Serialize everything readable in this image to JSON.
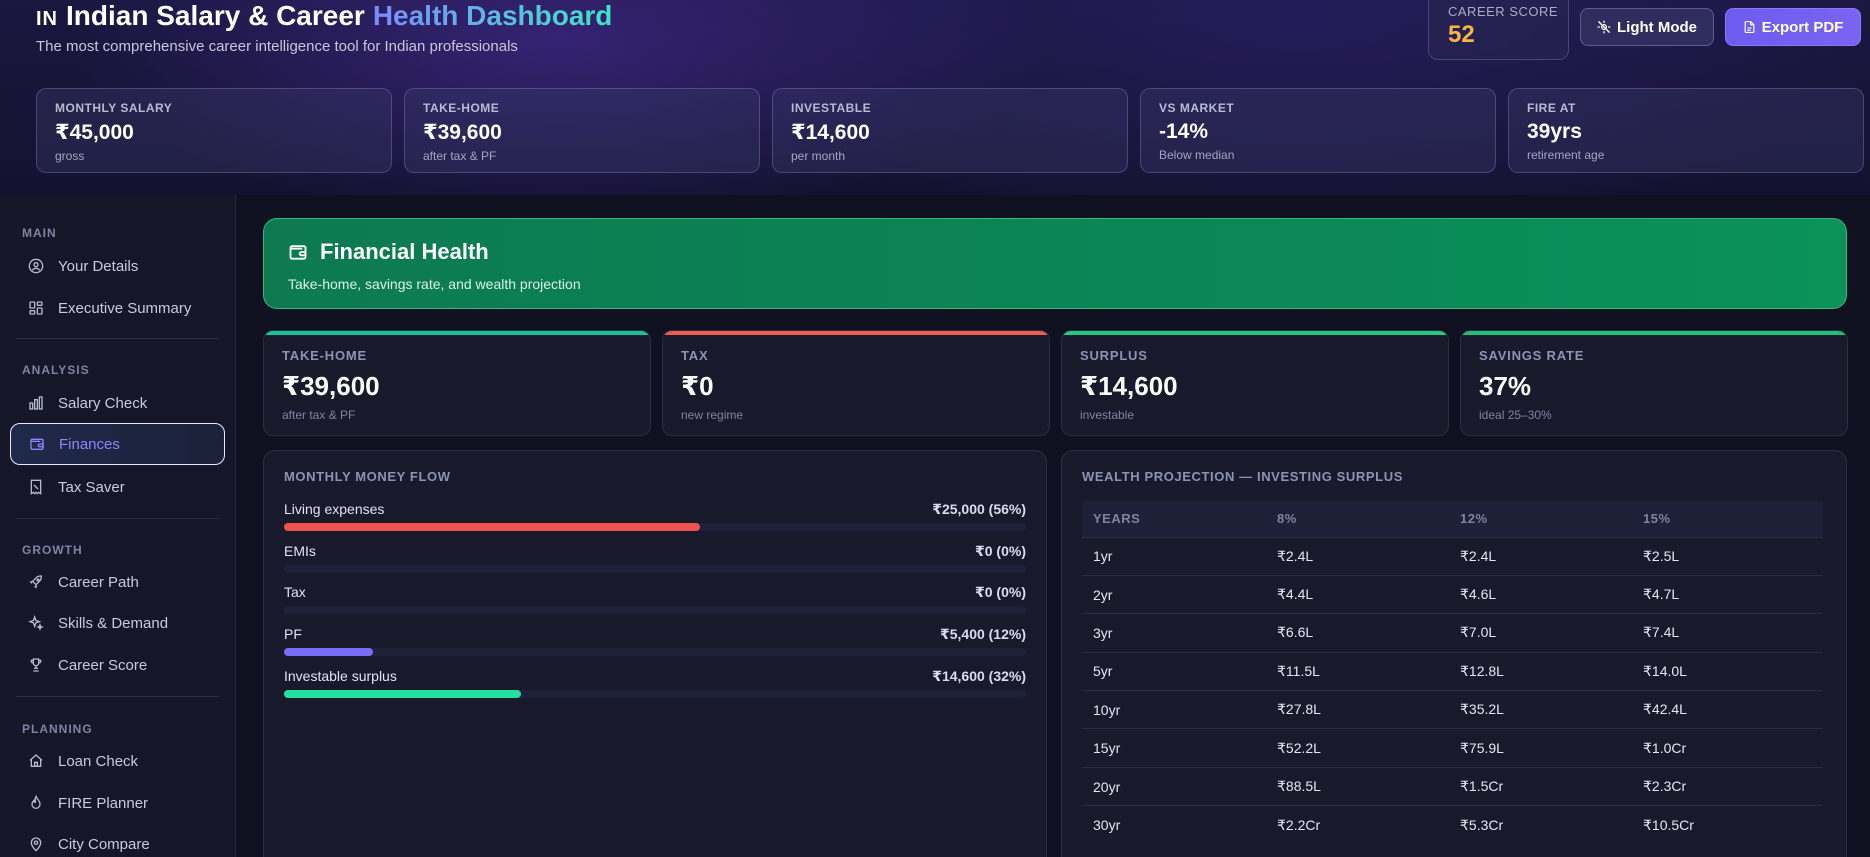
{
  "header": {
    "flag": "IN",
    "title_a": "Indian Salary & Career",
    "title_b": "Health Dashboard",
    "subtitle": "The most comprehensive career intelligence tool for Indian professionals",
    "career_score_label": "CAREER SCORE",
    "career_score_value": "52",
    "light_mode_label": "Light Mode",
    "export_pdf_label": "Export PDF"
  },
  "kpis": [
    {
      "label": "MONTHLY SALARY",
      "value": "₹45,000",
      "sub": "gross"
    },
    {
      "label": "TAKE-HOME",
      "value": "₹39,600",
      "sub": "after tax & PF"
    },
    {
      "label": "INVESTABLE",
      "value": "₹14,600",
      "sub": "per month"
    },
    {
      "label": "VS MARKET",
      "value": "-14%",
      "sub": "Below median"
    },
    {
      "label": "FIRE AT",
      "value": "39yrs",
      "sub": "retirement age"
    }
  ],
  "sidebar": {
    "sections": [
      "MAIN",
      "ANALYSIS",
      "GROWTH",
      "PLANNING"
    ],
    "items": [
      {
        "label": "Your Details",
        "icon": "user-circle-icon"
      },
      {
        "label": "Executive Summary",
        "icon": "grid-icon"
      },
      {
        "label": "Salary Check",
        "icon": "bar-chart-icon"
      },
      {
        "label": "Finances",
        "icon": "wallet-icon",
        "active": true
      },
      {
        "label": "Tax Saver",
        "icon": "receipt-icon"
      },
      {
        "label": "Career Path",
        "icon": "rocket-icon"
      },
      {
        "label": "Skills & Demand",
        "icon": "sparkles-icon"
      },
      {
        "label": "Career Score",
        "icon": "trophy-icon"
      },
      {
        "label": "Loan Check",
        "icon": "home-icon"
      },
      {
        "label": "FIRE Planner",
        "icon": "flame-icon"
      },
      {
        "label": "City Compare",
        "icon": "map-pin-icon"
      }
    ]
  },
  "banner": {
    "title": "Financial Health",
    "subtitle": "Take-home, savings rate, and wealth projection"
  },
  "stats": [
    {
      "label": "TAKE-HOME",
      "value": "₹39,600",
      "sub": "after tax & PF"
    },
    {
      "label": "TAX",
      "value": "₹0",
      "sub": "new regime"
    },
    {
      "label": "SURPLUS",
      "value": "₹14,600",
      "sub": "investable"
    },
    {
      "label": "SAVINGS RATE",
      "value": "37%",
      "sub": "ideal 25–30%"
    }
  ],
  "money_flow": {
    "title": "MONTHLY MONEY FLOW",
    "rows": [
      {
        "name": "Living expenses",
        "amount": "₹25,000 (56%)",
        "pct": 56,
        "color": "#ef5350"
      },
      {
        "name": "EMIs",
        "amount": "₹0 (0%)",
        "pct": 0,
        "color": "#ef5350"
      },
      {
        "name": "Tax",
        "amount": "₹0 (0%)",
        "pct": 0,
        "color": "#ef5350"
      },
      {
        "name": "PF",
        "amount": "₹5,400 (12%)",
        "pct": 12,
        "color": "#7b6cf6"
      },
      {
        "name": "Investable surplus",
        "amount": "₹14,600 (32%)",
        "pct": 32,
        "color": "#22e0a0"
      }
    ]
  },
  "wealth": {
    "title": "WEALTH PROJECTION — INVESTING SURPLUS",
    "headers": [
      "YEARS",
      "8%",
      "12%",
      "15%"
    ],
    "rows": [
      [
        "1yr",
        "₹2.4L",
        "₹2.4L",
        "₹2.5L"
      ],
      [
        "2yr",
        "₹4.4L",
        "₹4.6L",
        "₹4.7L"
      ],
      [
        "3yr",
        "₹6.6L",
        "₹7.0L",
        "₹7.4L"
      ],
      [
        "5yr",
        "₹11.5L",
        "₹12.8L",
        "₹14.0L"
      ],
      [
        "10yr",
        "₹27.8L",
        "₹35.2L",
        "₹42.4L"
      ],
      [
        "15yr",
        "₹52.2L",
        "₹75.9L",
        "₹1.0Cr"
      ],
      [
        "20yr",
        "₹88.5L",
        "₹1.5Cr",
        "₹2.3Cr"
      ],
      [
        "30yr",
        "₹2.2Cr",
        "₹5.3Cr",
        "₹10.5Cr"
      ]
    ]
  }
}
